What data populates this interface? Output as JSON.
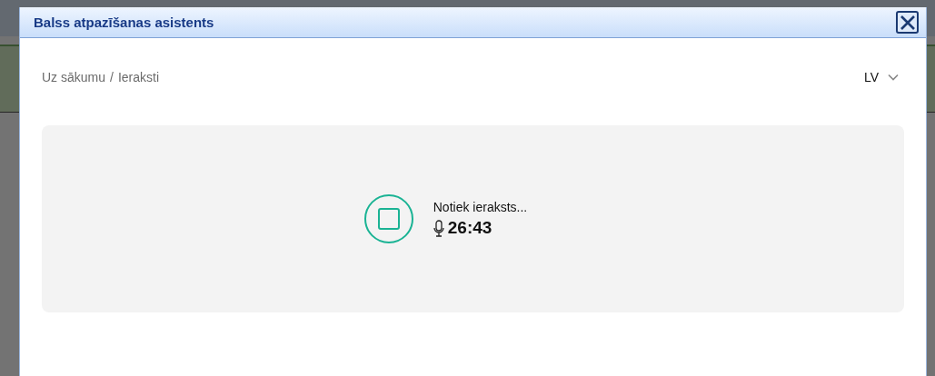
{
  "dialog": {
    "title": "Balss atpazīšanas asistents",
    "breadcrumb": [
      {
        "label": "Uz sākumu"
      },
      {
        "label": "/"
      },
      {
        "label": "Ieraksti"
      }
    ],
    "language": {
      "value": "LV"
    },
    "recording": {
      "status": "Notiek ieraksts...",
      "time": "26:43"
    }
  }
}
